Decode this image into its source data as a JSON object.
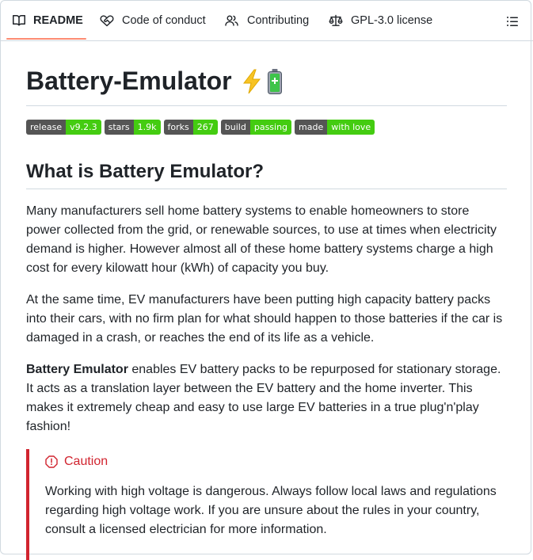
{
  "tabs": [
    {
      "label": "README",
      "icon": "book-icon"
    },
    {
      "label": "Code of conduct",
      "icon": "heart-handshake-icon"
    },
    {
      "label": "Contributing",
      "icon": "people-icon"
    },
    {
      "label": "GPL-3.0 license",
      "icon": "law-scale-icon"
    }
  ],
  "active_tab": "README",
  "title": "Battery-Emulator",
  "title_emoji": "⚡🔋",
  "badges": [
    {
      "label": "release",
      "value": "v9.2.3",
      "color": "#44cc11"
    },
    {
      "label": "stars",
      "value": "1.9k",
      "color": "#44cc11"
    },
    {
      "label": "forks",
      "value": "267",
      "color": "#44cc11"
    },
    {
      "label": "build",
      "value": "passing",
      "color": "#44cc11"
    },
    {
      "label": "made",
      "value": "with love",
      "color": "#44cc11"
    }
  ],
  "section_heading": "What is Battery Emulator?",
  "paragraphs": {
    "p1": "Many manufacturers sell home battery systems to enable homeowners to store power collected from the grid, or renewable sources, to use at times when electricity demand is higher. However almost all of these home battery systems charge a high cost for every kilowatt hour (kWh) of capacity you buy.",
    "p2": "At the same time, EV manufacturers have been putting high capacity battery packs into their cars, with no firm plan for what should happen to those batteries if the car is damaged in a crash, or reaches the end of its life as a vehicle.",
    "p3_bold": "Battery Emulator",
    "p3_rest": " enables EV battery packs to be repurposed for stationary storage. It acts as a translation layer between the EV battery and the home inverter. This makes it extremely cheap and easy to use large EV batteries in a true plug'n'play fashion!"
  },
  "caution": {
    "title": "Caution",
    "text": "Working with high voltage is dangerous. Always follow local laws and regulations regarding high voltage work. If you are unsure about the rules in your country, consult a licensed electrician for more information."
  },
  "colors": {
    "accent_underline": "#fd8c73",
    "caution": "#d1242f",
    "badge_value": "#44cc11"
  }
}
